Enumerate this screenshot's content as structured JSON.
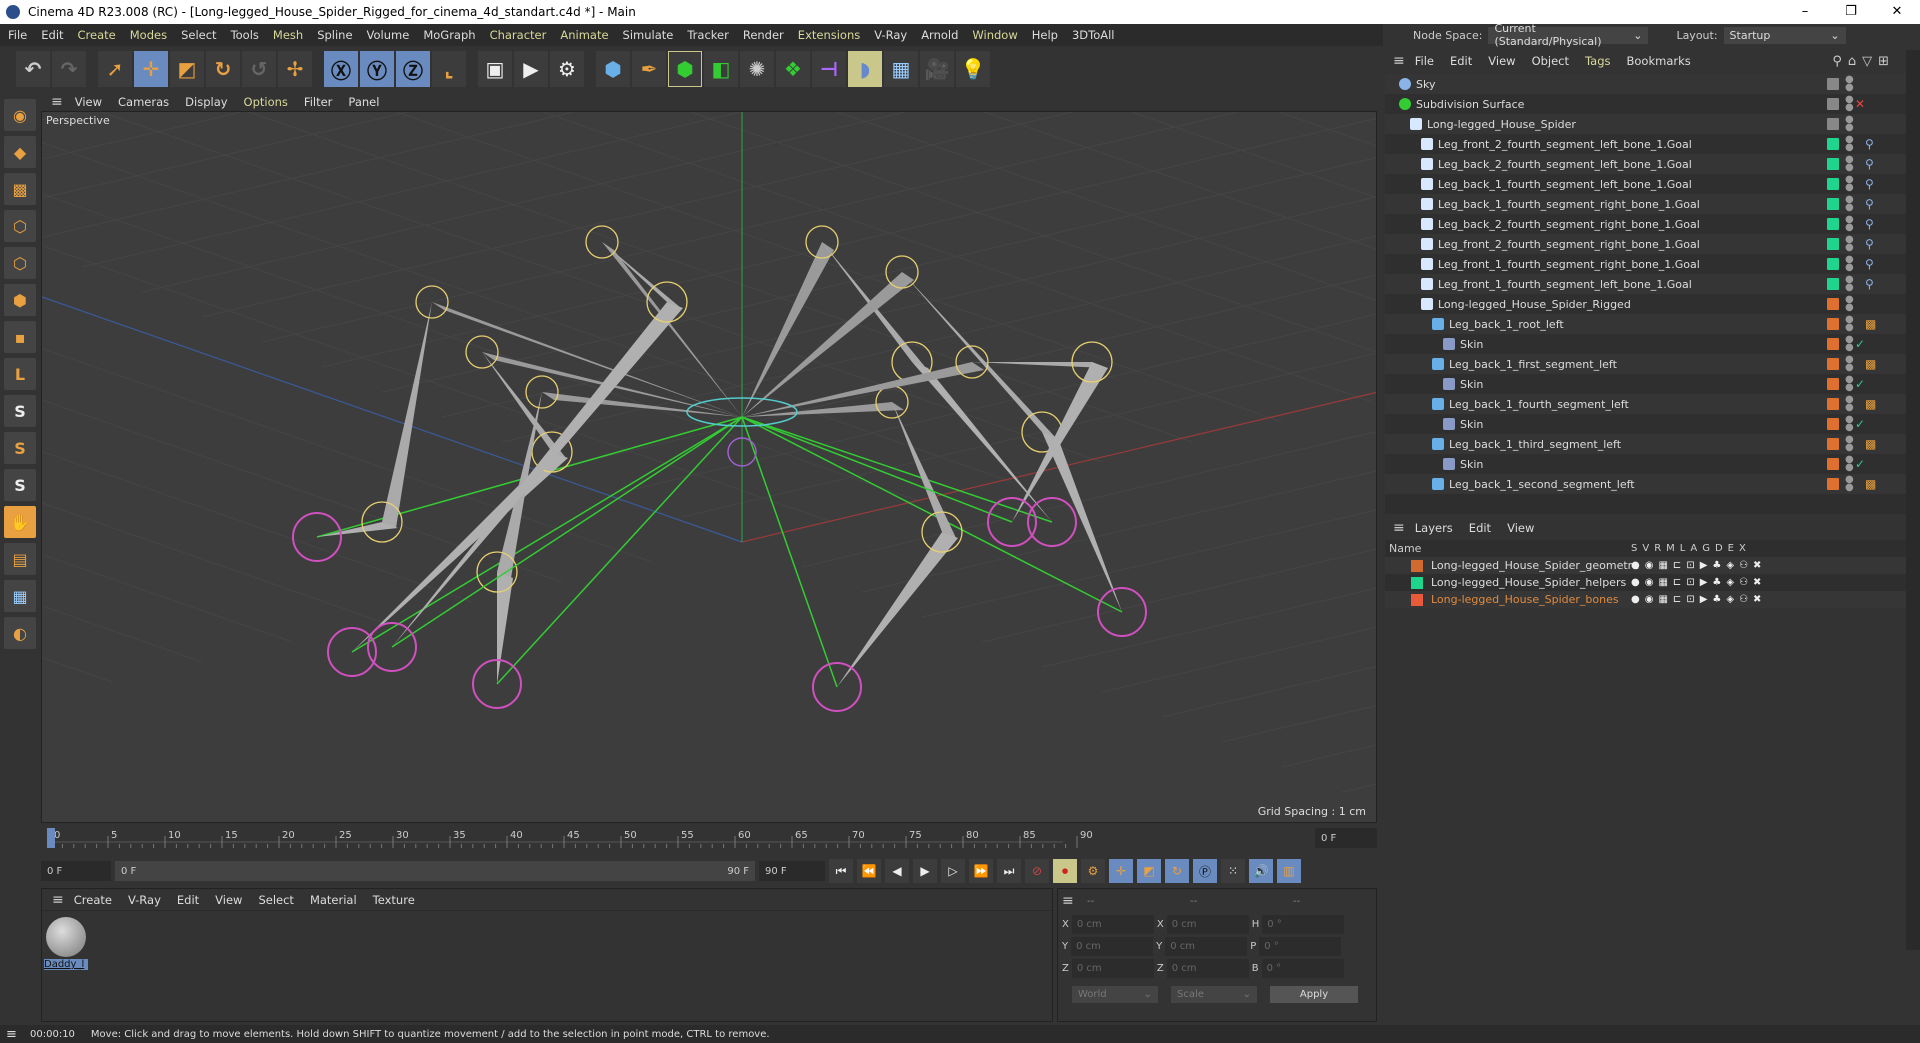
{
  "window": {
    "title": "Cinema 4D R23.008 (RC) - [Long-legged_House_Spider_Rigged_for_cinema_4d_standart.c4d *] - Main"
  },
  "menubar": [
    "File",
    "Edit",
    "Create",
    "Modes",
    "Select",
    "Tools",
    "Mesh",
    "Spline",
    "Volume",
    "MoGraph",
    "Character",
    "Animate",
    "Simulate",
    "Tracker",
    "Render",
    "Extensions",
    "V-Ray",
    "Arnold",
    "Window",
    "Help",
    "3DToAll"
  ],
  "nodespace": {
    "label": "Node Space:",
    "value": "Current (Standard/Physical)",
    "layout_label": "Layout:",
    "layout_value": "Startup"
  },
  "viewport": {
    "menu": [
      "View",
      "Cameras",
      "Display",
      "Options",
      "Filter",
      "Panel"
    ],
    "label": "Perspective",
    "grid_spacing": "Grid Spacing : 1 cm"
  },
  "object_manager": {
    "menu": [
      "File",
      "Edit",
      "View",
      "Object",
      "Tags",
      "Bookmarks"
    ],
    "rows": [
      {
        "name": "Sky",
        "indent": 0,
        "color": "#888888",
        "icon": "sky-icon"
      },
      {
        "name": "Subdivision Surface",
        "indent": 0,
        "color": "#888888",
        "icon": "subdivision-icon"
      },
      {
        "name": "Long-legged_House_Spider",
        "indent": 1,
        "color": "#888888",
        "icon": "null-icon"
      },
      {
        "name": "Leg_front_2_fourth_segment_left_bone_1.Goal",
        "indent": 2,
        "color": "#1fd48c",
        "icon": "null-icon"
      },
      {
        "name": "Leg_back_2_fourth_segment_left_bone_1.Goal",
        "indent": 2,
        "color": "#1fd48c",
        "icon": "null-icon"
      },
      {
        "name": "Leg_back_1_fourth_segment_left_bone_1.Goal",
        "indent": 2,
        "color": "#1fd48c",
        "icon": "null-icon"
      },
      {
        "name": "Leg_back_1_fourth_segment_right_bone_1.Goal",
        "indent": 2,
        "color": "#1fd48c",
        "icon": "null-icon"
      },
      {
        "name": "Leg_back_2_fourth_segment_right_bone_1.Goal",
        "indent": 2,
        "color": "#1fd48c",
        "icon": "null-icon"
      },
      {
        "name": "Leg_front_2_fourth_segment_right_bone_1.Goal",
        "indent": 2,
        "color": "#1fd48c",
        "icon": "null-icon"
      },
      {
        "name": "Leg_front_1_fourth_segment_right_bone_1.Goal",
        "indent": 2,
        "color": "#1fd48c",
        "icon": "null-icon"
      },
      {
        "name": "Leg_front_1_fourth_segment_left_bone_1.Goal",
        "indent": 2,
        "color": "#1fd48c",
        "icon": "null-icon"
      },
      {
        "name": "Long-legged_House_Spider_Rigged",
        "indent": 2,
        "color": "#e07030",
        "icon": "null-icon"
      },
      {
        "name": "Leg_back_1_root_left",
        "indent": 3,
        "color": "#e07030",
        "icon": "joint-icon"
      },
      {
        "name": "Skin",
        "indent": 4,
        "color": "#e07030",
        "icon": "skin-icon"
      },
      {
        "name": "Leg_back_1_first_segment_left",
        "indent": 3,
        "color": "#e07030",
        "icon": "joint-icon"
      },
      {
        "name": "Skin",
        "indent": 4,
        "color": "#e07030",
        "icon": "skin-icon"
      },
      {
        "name": "Leg_back_1_fourth_segment_left",
        "indent": 3,
        "color": "#e07030",
        "icon": "joint-icon"
      },
      {
        "name": "Skin",
        "indent": 4,
        "color": "#e07030",
        "icon": "skin-icon"
      },
      {
        "name": "Leg_back_1_third_segment_left",
        "indent": 3,
        "color": "#e07030",
        "icon": "joint-icon"
      },
      {
        "name": "Skin",
        "indent": 4,
        "color": "#e07030",
        "icon": "skin-icon"
      },
      {
        "name": "Leg_back_1_second_segment_left",
        "indent": 3,
        "color": "#e07030",
        "icon": "joint-icon"
      }
    ]
  },
  "layers": {
    "menu": [
      "Layers",
      "Edit",
      "View"
    ],
    "name_header": "Name",
    "flags": [
      "S",
      "V",
      "R",
      "M",
      "L",
      "A",
      "G",
      "D",
      "E",
      "X"
    ],
    "rows": [
      {
        "name": "Long-legged_House_Spider_geometru",
        "color": "#d06a30",
        "text_color": "#dddddd"
      },
      {
        "name": "Long-legged_House_Spider_helpers",
        "color": "#1fd48c",
        "text_color": "#dddddd"
      },
      {
        "name": "Long-legged_House_Spider_bones",
        "color": "#e85a3a",
        "text_color": "#e08a40"
      }
    ]
  },
  "timeline": {
    "ticks": [
      "0",
      "5",
      "10",
      "15",
      "20",
      "25",
      "30",
      "35",
      "40",
      "45",
      "50",
      "55",
      "60",
      "65",
      "70",
      "75",
      "80",
      "85",
      "90"
    ],
    "current_frame": "0 F",
    "start": "0 F",
    "range_start": "0 F",
    "range_end": "90 F",
    "end": "90 F"
  },
  "material": {
    "menu": [
      "Create",
      "V-Ray",
      "Edit",
      "View",
      "Select",
      "Material",
      "Texture"
    ],
    "items": [
      {
        "name": "Daddy_l"
      }
    ]
  },
  "coords": {
    "headers": [
      "--",
      "--",
      "--"
    ],
    "rows": [
      {
        "a": "X",
        "av": "0 cm",
        "b": "X",
        "bv": "0 cm",
        "c": "H",
        "cv": "0 °"
      },
      {
        "a": "Y",
        "av": "0 cm",
        "b": "Y",
        "bv": "0 cm",
        "c": "P",
        "cv": "0 °"
      },
      {
        "a": "Z",
        "av": "0 cm",
        "b": "Z",
        "bv": "0 cm",
        "c": "B",
        "cv": "0 °"
      }
    ],
    "world": "World",
    "scale": "Scale",
    "apply": "Apply"
  },
  "status": {
    "time": "00:00:10",
    "message": "Move: Click and drag to move elements. Hold down SHIFT to quantize movement / add to the selection in point mode, CTRL to remove."
  }
}
